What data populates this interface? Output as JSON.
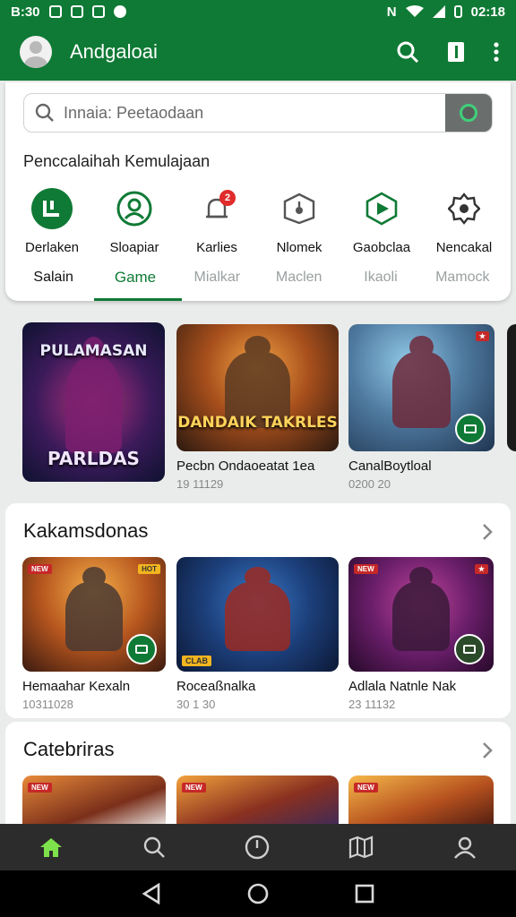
{
  "status_bar": {
    "time_left": "B:30",
    "time_right": "02:18"
  },
  "app_bar": {
    "title": "Andgaloai",
    "actions": [
      "search-icon",
      "book-icon",
      "more-vert-icon"
    ]
  },
  "search": {
    "placeholder": "Innaia: Peetaodaan"
  },
  "section_label": "Penccalaihah Kemulajaan",
  "quick_actions": [
    {
      "label": "Derlaken",
      "icon": "store-icon"
    },
    {
      "label": "Sloapiar",
      "icon": "person-icon"
    },
    {
      "label": "Karlies",
      "icon": "bell-icon",
      "badge": "2"
    },
    {
      "label": "Nlomek",
      "icon": "pentagon-icon"
    },
    {
      "label": "Gaobclaa",
      "icon": "play-icon"
    },
    {
      "label": "Nencakal",
      "icon": "gear-icon"
    }
  ],
  "tabs": [
    {
      "label": "Salain",
      "state": "default"
    },
    {
      "label": "Game",
      "state": "active"
    },
    {
      "label": "Mialkar",
      "state": "muted"
    },
    {
      "label": "Maclen",
      "state": "muted"
    },
    {
      "label": "Ikaoli",
      "state": "muted"
    },
    {
      "label": "Mamock",
      "state": "muted"
    }
  ],
  "featured": [
    {
      "art_top": "PULAMASAN",
      "art_bottom": "PARLDAS",
      "title": "",
      "meta": ""
    },
    {
      "art_text": "DANDAIK TAKRLES",
      "title": "Pecbn Ondaoeatat 1ea",
      "meta": "19 11129"
    },
    {
      "title": "CanalBoytloal",
      "meta": "0200 20"
    }
  ],
  "recommended": {
    "title": "Kakamsdonas",
    "games": [
      {
        "title": "Hemaahar Kexaln",
        "meta": "10311028",
        "badge": "NEW",
        "badge2": "HOT"
      },
      {
        "title": "Roceaßnalka",
        "meta": "30 1 30",
        "badge": "CLAB"
      },
      {
        "title": "Adlala Natnle Nak",
        "meta": "23 11132",
        "badge": "NEW"
      }
    ]
  },
  "categories": {
    "title": "Catebriras"
  },
  "bottom_nav": [
    "home-icon",
    "search-icon",
    "power-icon",
    "map-icon",
    "profile-icon"
  ],
  "colors": {
    "primary": "#0f7a35",
    "accent_active": "#7ee04a"
  }
}
